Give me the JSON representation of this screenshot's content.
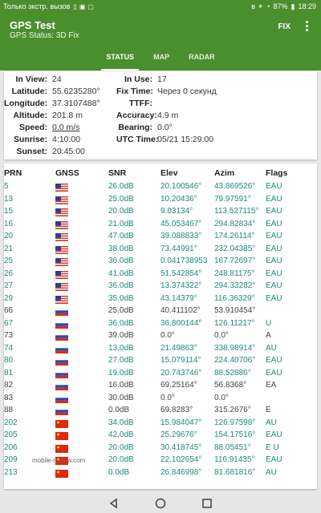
{
  "status_bar": {
    "carrier": "Только экстр. вызов",
    "battery": "87%",
    "time": "18:29"
  },
  "app": {
    "title": "GPS Test",
    "subtitle": "GPS Status: 3D Fix",
    "fix_label": "FIX",
    "accent_color": "#4a8f2e",
    "data_color": "#1b8a7a"
  },
  "tabs": [
    {
      "label": "STATUS",
      "active": true
    },
    {
      "label": "MAP",
      "active": false
    },
    {
      "label": "RADAR",
      "active": false
    }
  ],
  "status": {
    "in_view_label": "In View:",
    "in_view": "24",
    "in_use_label": "In Use:",
    "in_use": "17",
    "latitude_label": "Latitude:",
    "latitude": "55.6235280°",
    "fix_time_label": "Fix Time:",
    "fix_time": "Через 0 секунд",
    "longitude_label": "Longitude:",
    "longitude": "37.3107488°",
    "ttff_label": "TTFF:",
    "ttff": "",
    "altitude_label": "Altitude:",
    "altitude": "201.8 m",
    "accuracy_label": "Accuracy:",
    "accuracy": "4.9 m",
    "speed_label": "Speed:",
    "speed": "0.0 m/s",
    "bearing_label": "Bearing:",
    "bearing": "0.0°",
    "sunrise_label": "Sunrise:",
    "sunrise": "4:10:00",
    "utc_label": "UTC Time:",
    "utc": "05/21 15:29:00",
    "sunset_label": "Sunset:",
    "sunset": "20:45:00"
  },
  "table": {
    "headers": {
      "prn": "PRN",
      "gnss": "GNSS",
      "snr": "SNR",
      "elev": "Elev",
      "azim": "Azim",
      "flags": "Flags"
    },
    "rows": [
      {
        "prn": "5",
        "gnss": "us-flag-icon",
        "snr": "26.0dB",
        "elev": "20.100546°",
        "azim": "43.869526°",
        "flags": "EAU",
        "used": true
      },
      {
        "prn": "13",
        "gnss": "us-flag-icon",
        "snr": "25.0dB",
        "elev": "10.20436°",
        "azim": "79.97591°",
        "flags": "EAU",
        "used": true
      },
      {
        "prn": "15",
        "gnss": "us-flag-icon",
        "snr": "20.0dB",
        "elev": "9.03134°",
        "azim": "113.527115°",
        "flags": "EAU",
        "used": true
      },
      {
        "prn": "16",
        "gnss": "us-flag-icon",
        "snr": "21.0dB",
        "elev": "45.053467°",
        "azim": "294.82834°",
        "flags": "EAU",
        "used": true
      },
      {
        "prn": "20",
        "gnss": "us-flag-icon",
        "snr": "47.0dB",
        "elev": "39.088833°",
        "azim": "174.26114°",
        "flags": "EAU",
        "used": true
      },
      {
        "prn": "21",
        "gnss": "us-flag-icon",
        "snr": "38.0dB",
        "elev": "73.44991°",
        "azim": "232.04385°",
        "flags": "EAU",
        "used": true
      },
      {
        "prn": "25",
        "gnss": "us-flag-icon",
        "snr": "36.0dB",
        "elev": "0.041738953",
        "azim": "167.72697°",
        "flags": "EAU",
        "used": true
      },
      {
        "prn": "26",
        "gnss": "us-flag-icon",
        "snr": "41.0dB",
        "elev": "51.542854°",
        "azim": "248.81175°",
        "flags": "EAU",
        "used": true
      },
      {
        "prn": "27",
        "gnss": "us-flag-icon",
        "snr": "36.0dB",
        "elev": "13.374322°",
        "azim": "294.33282°",
        "flags": "EAU",
        "used": true
      },
      {
        "prn": "29",
        "gnss": "us-flag-icon",
        "snr": "35.0dB",
        "elev": "43.14379°",
        "azim": "116.36329°",
        "flags": "EAU",
        "used": true
      },
      {
        "prn": "66",
        "gnss": "ru-flag-icon",
        "snr": "25.0dB",
        "elev": "40.411102°",
        "azim": "53.910454°",
        "flags": "",
        "used": false
      },
      {
        "prn": "67",
        "gnss": "ru-flag-icon",
        "snr": "36.0dB",
        "elev": "36.800144°",
        "azim": "126.11217°",
        "flags": "U",
        "used": true
      },
      {
        "prn": "73",
        "gnss": "ru-flag-icon",
        "snr": "39.0dB",
        "elev": "0.0°",
        "azim": "0.0°",
        "flags": "A",
        "used": false
      },
      {
        "prn": "74",
        "gnss": "ru-flag-icon",
        "snr": "13.0dB",
        "elev": "21.49863°",
        "azim": "338.98914°",
        "flags": "AU",
        "used": true
      },
      {
        "prn": "80",
        "gnss": "ru-flag-icon",
        "snr": "27.0dB",
        "elev": "15.079114°",
        "azim": "224.40706°",
        "flags": "EAU",
        "used": true
      },
      {
        "prn": "81",
        "gnss": "ru-flag-icon",
        "snr": "19.0dB",
        "elev": "20.743746°",
        "azim": "88.52886°",
        "flags": "EAU",
        "used": true
      },
      {
        "prn": "82",
        "gnss": "ru-flag-icon",
        "snr": "16.0dB",
        "elev": "69.25164°",
        "azim": "56.8368°",
        "flags": "EA",
        "used": false
      },
      {
        "prn": "83",
        "gnss": "ru-flag-icon",
        "snr": "30.0dB",
        "elev": "0.0°",
        "azim": "0.0°",
        "flags": "",
        "used": false
      },
      {
        "prn": "88",
        "gnss": "ru-flag-icon",
        "snr": "0.0dB",
        "elev": "69.8283°",
        "azim": "315.2676°",
        "flags": "E",
        "used": false
      },
      {
        "prn": "202",
        "gnss": "cn-flag-icon",
        "snr": "34.0dB",
        "elev": "15.984047°",
        "azim": "126.97598°",
        "flags": "AU",
        "used": true
      },
      {
        "prn": "205",
        "gnss": "cn-flag-icon",
        "snr": "42.0dB",
        "elev": "25.29676°",
        "azim": "154.17516°",
        "flags": "EAU",
        "used": true
      },
      {
        "prn": "206",
        "gnss": "cn-flag-icon",
        "snr": "20.0dB",
        "elev": "30.418745°",
        "azim": "88.05451°",
        "flags": "E U",
        "used": true
      },
      {
        "prn": "209",
        "gnss": "cn-flag-icon",
        "snr": "20.0dB",
        "elev": "22.102654°",
        "azim": "116.91435°",
        "flags": "EAU",
        "used": true
      },
      {
        "prn": "213",
        "gnss": "cn-flag-icon",
        "snr": "0.0dB",
        "elev": "26.846998°",
        "azim": "81.681816°",
        "flags": "AU",
        "used": true
      }
    ]
  },
  "watermark": "mobile-review.com"
}
